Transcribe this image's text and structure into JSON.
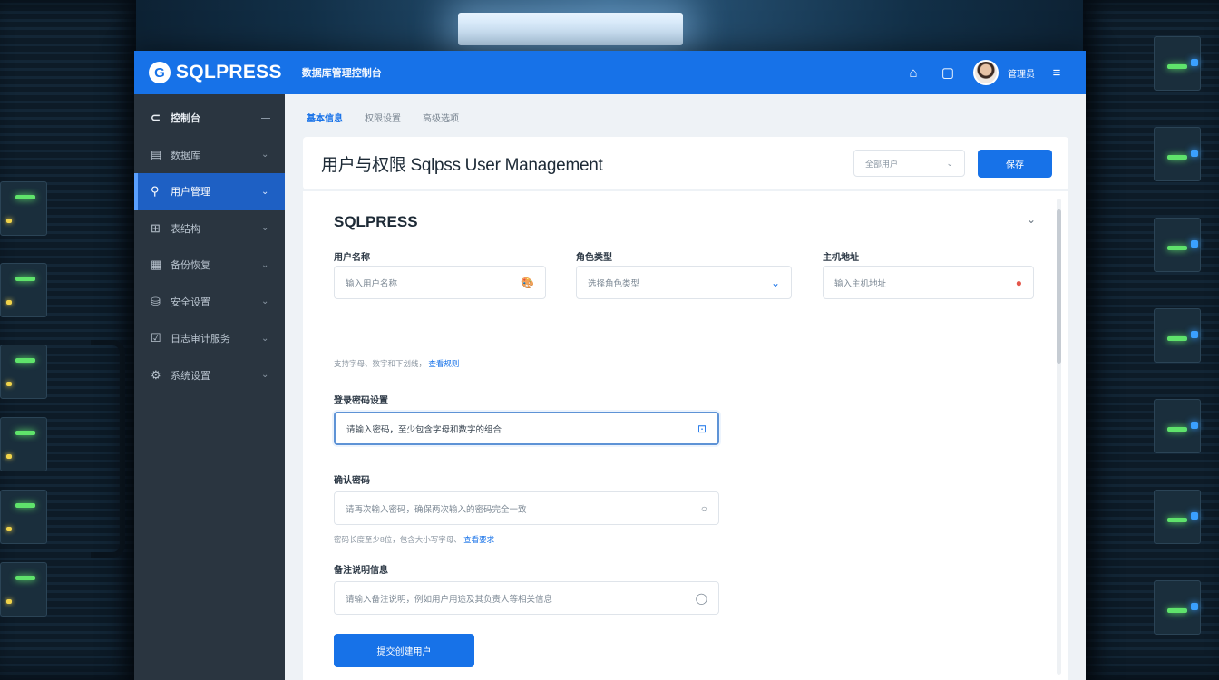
{
  "topbar": {
    "logo_glyph": "G",
    "logo_text": "SQLPRESS",
    "subtitle": "数据库管理控制台",
    "home_icon": "home-icon",
    "window_icon": "window-icon",
    "user_name": "管理员",
    "menu_icon": "menu-icon"
  },
  "sidebar": {
    "items": [
      {
        "icon": "⊂",
        "label": "控制台",
        "chev": "—"
      },
      {
        "icon": "▤",
        "label": "数据库",
        "chev": "⌄"
      },
      {
        "icon": "⚲",
        "label": "用户管理",
        "chev": "⌄"
      },
      {
        "icon": "⊞",
        "label": "表结构",
        "chev": "⌄"
      },
      {
        "icon": "▦",
        "label": "备份恢复",
        "chev": "⌄"
      },
      {
        "icon": "⛁",
        "label": "安全设置",
        "chev": "⌄"
      },
      {
        "icon": "☑",
        "label": "日志审计服务",
        "chev": "⌄"
      },
      {
        "icon": "⚙",
        "label": "系统设置",
        "chev": "⌄"
      }
    ]
  },
  "tabs": [
    "基本信息",
    "权限设置",
    "高级选项"
  ],
  "header": {
    "title": "用户与权限 Sqlpss User Management",
    "select_value": "全部用户",
    "button_label": "保存"
  },
  "section": {
    "title": "SQLPRESS"
  },
  "fields": {
    "username": {
      "label": "用户名称",
      "value": "输入用户名称",
      "icon": "🎨"
    },
    "role": {
      "label": "角色类型",
      "value": "选择角色类型",
      "icon": "⌄"
    },
    "host": {
      "label": "主机地址",
      "value": "输入主机地址",
      "icon": "●"
    },
    "hint1": {
      "text": "支持字母、数字和下划线，",
      "link": "查看规则"
    },
    "password": {
      "label": "登录密码设置",
      "value": "请输入密码，至少包含字母和数字的组合",
      "icon": "⊡"
    },
    "confirm": {
      "label": "确认密码",
      "value": "请再次输入密码，确保两次输入的密码完全一致",
      "icon": "○"
    },
    "hint2": {
      "text": "密码长度至少8位，包含大小写字母、",
      "link": "查看要求"
    },
    "remark": {
      "label": "备注说明信息",
      "value": "请输入备注说明，例如用户用途及其负责人等相关信息",
      "icon": "◯"
    }
  },
  "submit": {
    "label": "提交创建用户"
  },
  "colors": {
    "accent": "#1772e8",
    "sidebar": "#2a3540",
    "active_item": "#1e60c4"
  }
}
